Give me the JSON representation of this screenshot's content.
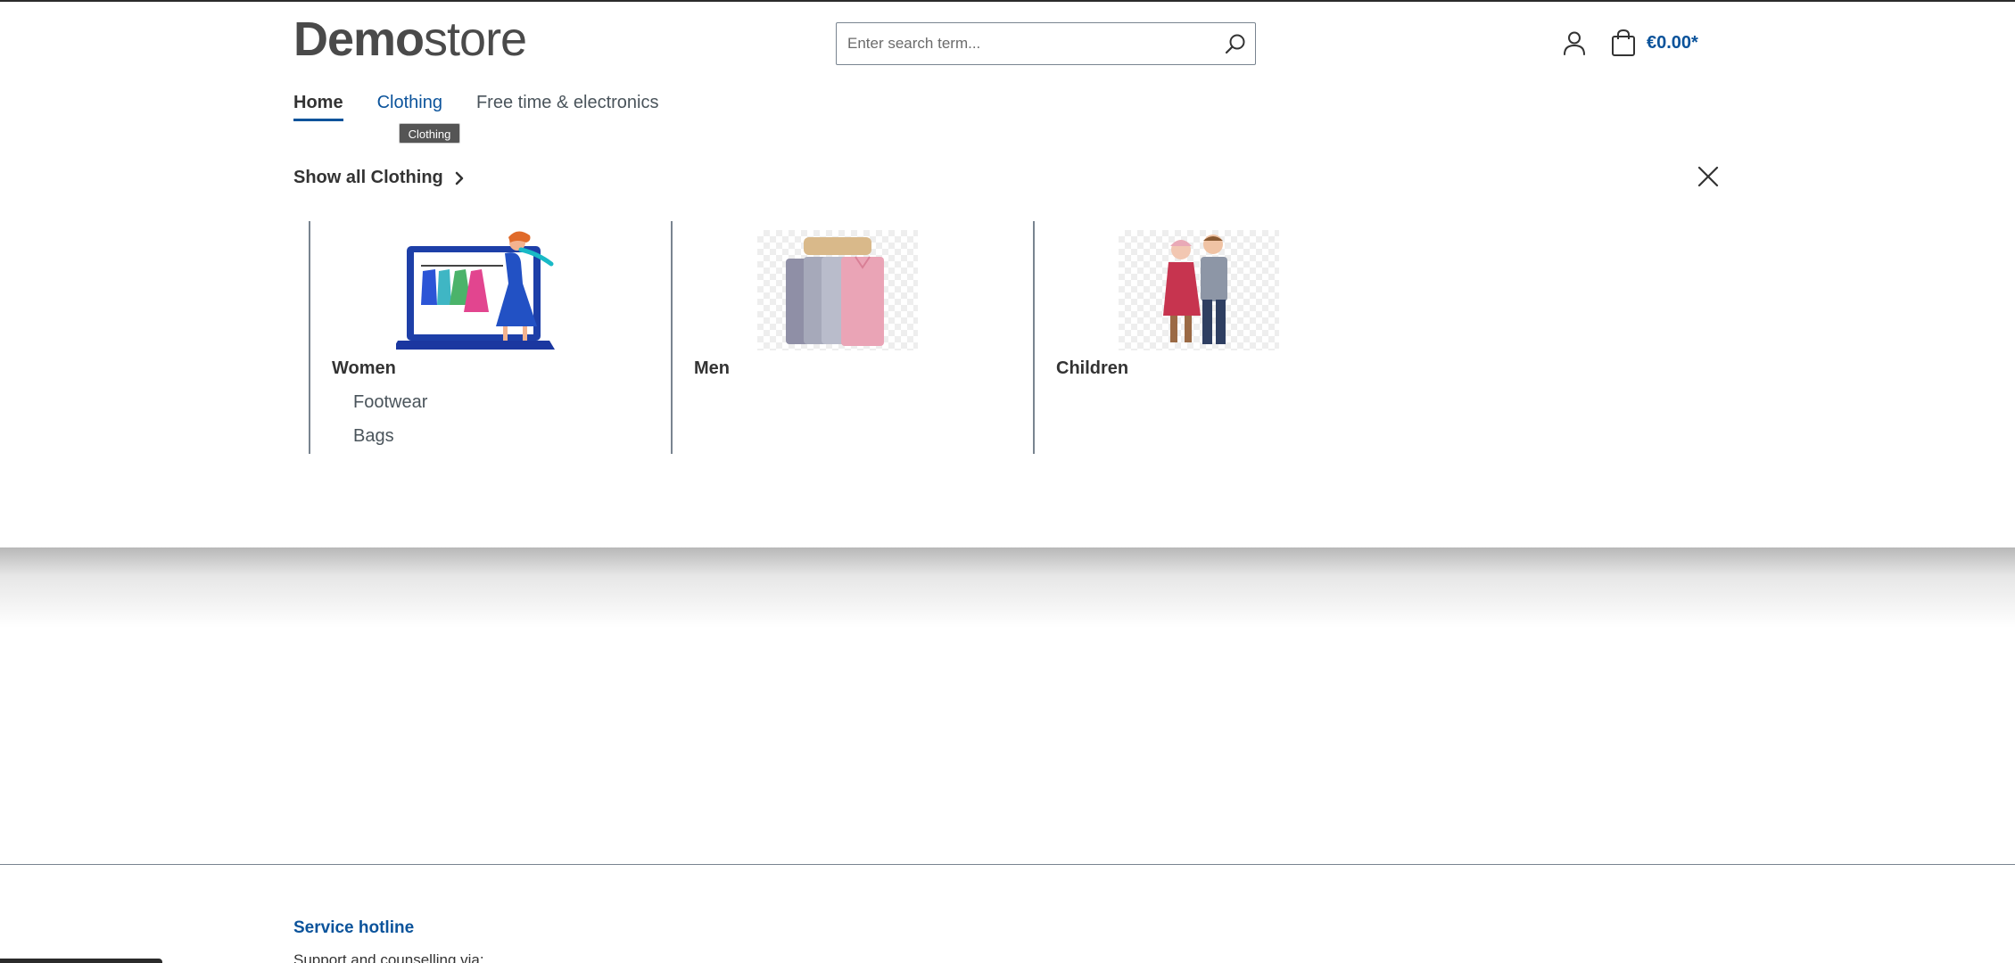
{
  "header": {
    "logo_bold": "Demo",
    "logo_light": "store",
    "search_placeholder": "Enter search term...",
    "cart_total": "€0.00*"
  },
  "nav": {
    "items": [
      {
        "label": "Home"
      },
      {
        "label": "Clothing"
      },
      {
        "label": "Free time & electronics"
      }
    ],
    "tooltip": "Clothing"
  },
  "flyout": {
    "show_all_label": "Show all Clothing",
    "categories": [
      {
        "title": "Women",
        "subcategories": [
          "Footwear",
          "Bags"
        ]
      },
      {
        "title": "Men",
        "subcategories": []
      },
      {
        "title": "Children",
        "subcategories": []
      }
    ]
  },
  "footer": {
    "hotline_title": "Service hotline",
    "hotline_subtitle": "Support and counselling via:"
  },
  "colors": {
    "accent": "#0b539b",
    "text": "#4a545b",
    "border": "#798490"
  }
}
